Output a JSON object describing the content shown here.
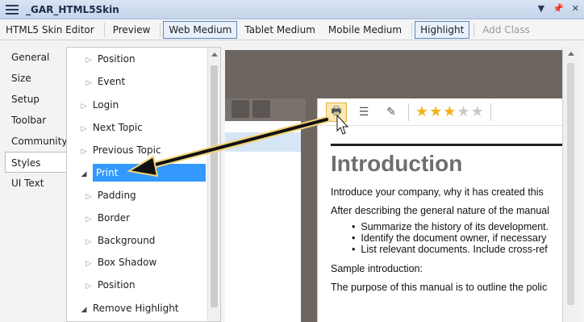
{
  "window": {
    "title": "_GAR_HTML5Skin",
    "controls": [
      "▼",
      "📌",
      "✕"
    ]
  },
  "toolbar": {
    "items": [
      {
        "label": "HTML5 Skin Editor",
        "state": "normal"
      },
      {
        "label": "Preview",
        "state": "normal"
      },
      {
        "label": "Web Medium",
        "state": "selected"
      },
      {
        "label": "Tablet Medium",
        "state": "normal"
      },
      {
        "label": "Mobile Medium",
        "state": "normal"
      },
      {
        "label": "Highlight",
        "state": "selected"
      },
      {
        "label": "Add Class",
        "state": "disabled"
      }
    ]
  },
  "sidebar": {
    "tabs": [
      {
        "label": "General"
      },
      {
        "label": "Size"
      },
      {
        "label": "Setup"
      },
      {
        "label": "Toolbar"
      },
      {
        "label": "Community"
      },
      {
        "label": "Styles",
        "selected": true
      },
      {
        "label": "UI Text"
      }
    ]
  },
  "tree": {
    "items": [
      {
        "label": "Position",
        "expander": "▷"
      },
      {
        "label": "Event",
        "expander": "▷"
      },
      {
        "label": "Login",
        "expander": "▷"
      },
      {
        "label": "Next Topic",
        "expander": "▷"
      },
      {
        "label": "Previous Topic",
        "expander": "▷"
      },
      {
        "label": "Print",
        "expander": "◢",
        "selected": true
      },
      {
        "label": "Padding",
        "expander": "▷"
      },
      {
        "label": "Border",
        "expander": "▷"
      },
      {
        "label": "Background",
        "expander": "▷"
      },
      {
        "label": "Box Shadow",
        "expander": "▷"
      },
      {
        "label": "Position",
        "expander": "▷"
      },
      {
        "label": "Remove Highlight",
        "expander": "◢"
      }
    ]
  },
  "preview": {
    "toolbar_icons": [
      "print-icon",
      "list-icon",
      "edit-icon"
    ],
    "rating": {
      "value": 3,
      "max": 5
    },
    "doc": {
      "heading": "Introduction",
      "p1": "Introduce your company, why it has created this",
      "p2": "After describing the general nature of the manual",
      "bullets": [
        "Summarize the history of its development.",
        "Identify the document owner, if necessary",
        "List relevant documents. Include cross-ref"
      ],
      "p3": "Sample introduction:",
      "p4": "The purpose of this manual is to outline the polic"
    }
  },
  "colors": {
    "accent": "#3399ff",
    "arrow": "#111111",
    "arrow_outline": "#f2d37a",
    "preview_bg": "#6c6560"
  }
}
